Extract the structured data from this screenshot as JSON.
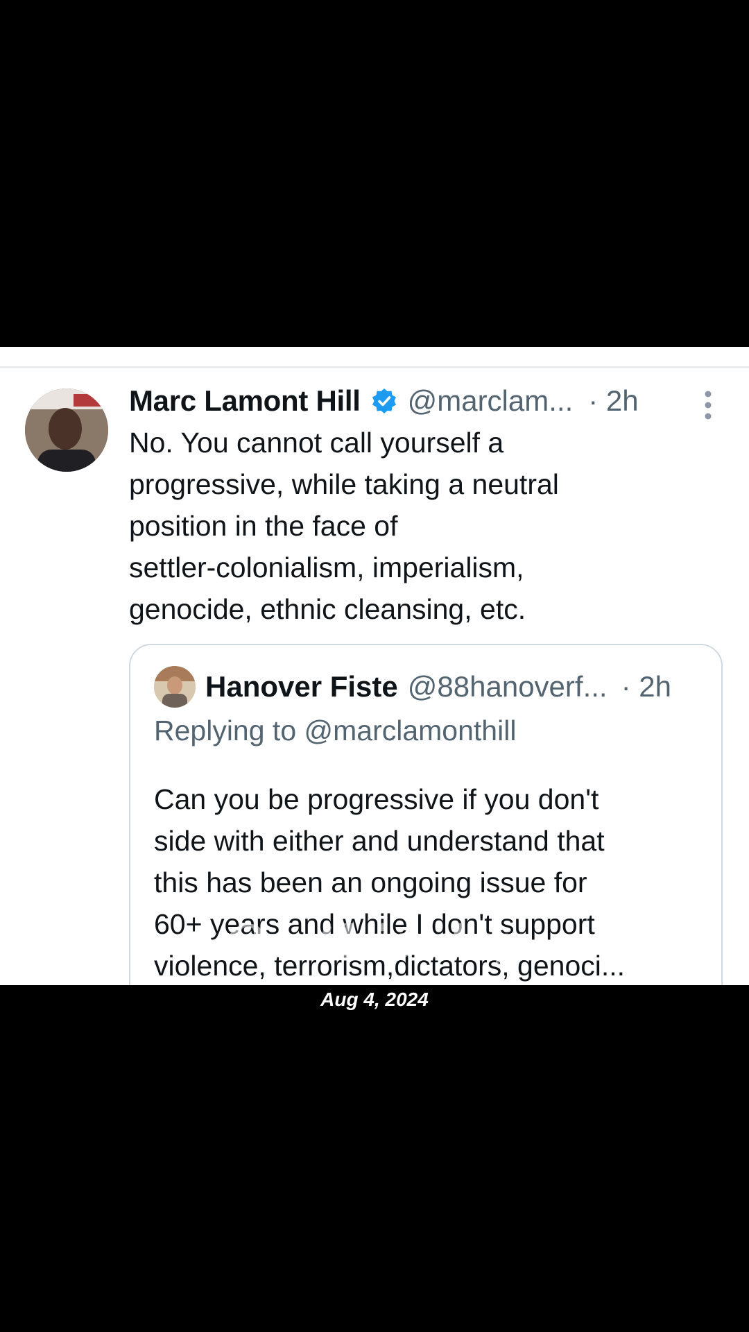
{
  "tweet": {
    "display_name": "Marc Lamont Hill",
    "handle": "@marclam...",
    "time": "· 2h",
    "body_lines": [
      "No. You cannot call yourself a",
      "progressive, while taking a neutral",
      "position in the face of",
      "settler-colonialism, imperialism,",
      "genocide, ethnic cleansing, etc."
    ],
    "verified_color": "#1d9bf0"
  },
  "quote": {
    "display_name": "Hanover Fiste",
    "handle": "@88hanoverf...",
    "time": "· 2h",
    "replying_to": "Replying to @marclamonthill",
    "body_lines": [
      "Can you be progressive if you don't",
      "side with either and understand that",
      "this has been an ongoing issue for",
      "60+ years and while I don't support",
      "violence, terrorism,dictators, genoci..."
    ]
  },
  "overlay": {
    "watermark": "On this day",
    "date": "Aug 4, 2024"
  },
  "icons": {
    "verified": "verified-badge-icon",
    "more": "more-vertical-icon"
  }
}
